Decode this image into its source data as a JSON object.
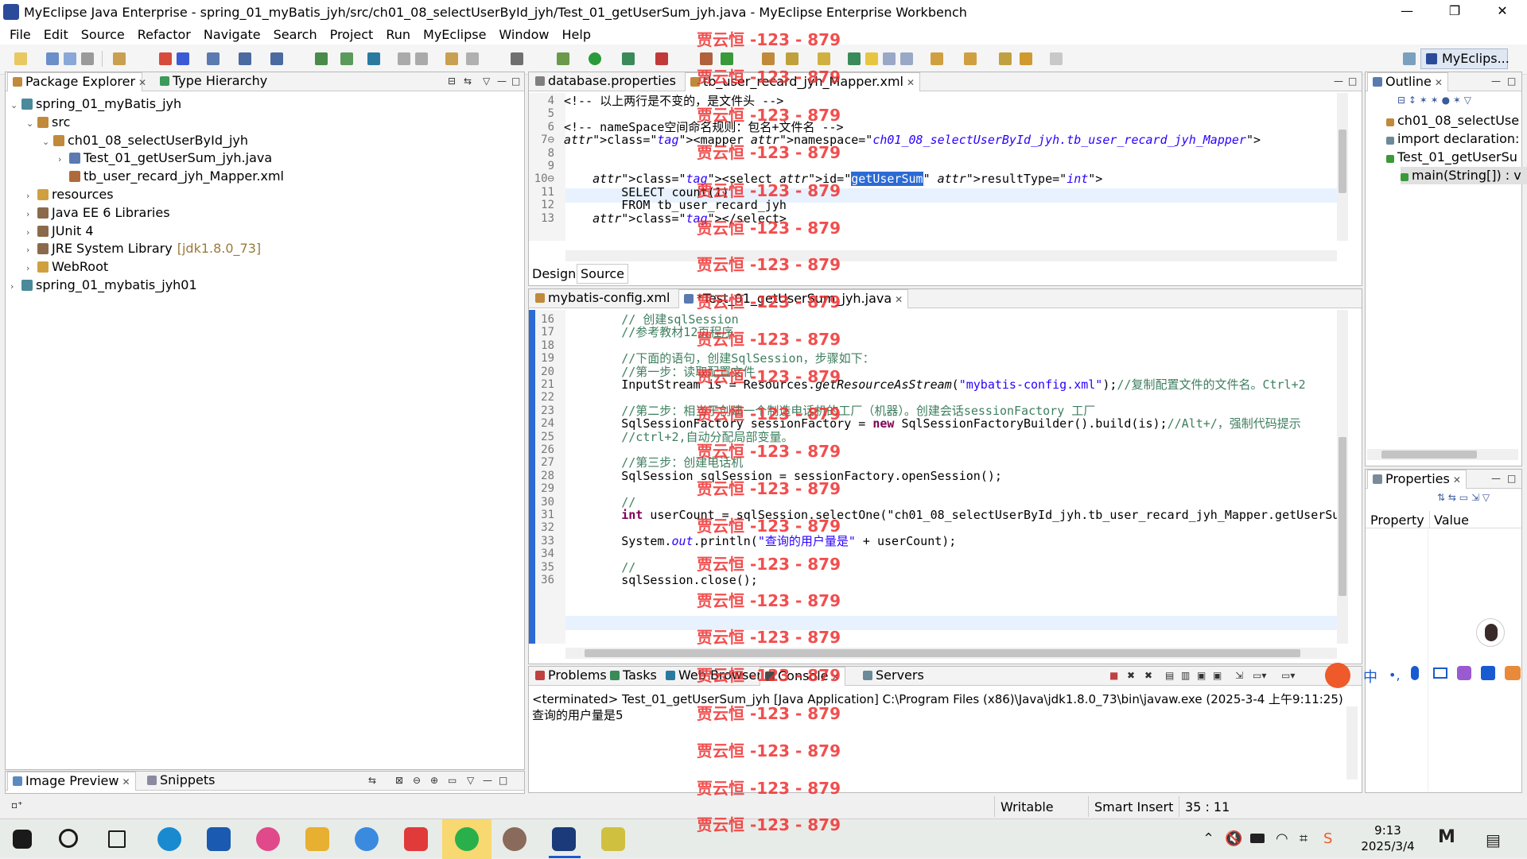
{
  "window": {
    "title": "MyEclipse Java Enterprise - spring_01_myBatis_jyh/src/ch01_08_selectUserById_jyh/Test_01_getUserSum_jyh.java - MyEclipse Enterprise Workbench",
    "minimize": "—",
    "restore": "❐",
    "close": "✕"
  },
  "menu": [
    "File",
    "Edit",
    "Source",
    "Refactor",
    "Navigate",
    "Search",
    "Project",
    "Run",
    "MyEclipse",
    "Window",
    "Help"
  ],
  "perspective": {
    "label": "MyEclips..."
  },
  "package_explorer": {
    "tabs": [
      {
        "label": "Package Explorer"
      },
      {
        "label": "Type Hierarchy"
      }
    ],
    "tree": [
      {
        "label": "spring_01_myBatis_jyh",
        "depth": 0,
        "arrow": "⌄",
        "icon": "project-icon"
      },
      {
        "label": "src",
        "depth": 1,
        "arrow": "⌄",
        "icon": "source-folder-icon"
      },
      {
        "label": "ch01_08_selectUserById_jyh",
        "depth": 2,
        "arrow": "⌄",
        "icon": "package-icon"
      },
      {
        "label": "Test_01_getUserSum_jyh.java",
        "depth": 3,
        "arrow": "›",
        "icon": "java-file-icon"
      },
      {
        "label": "tb_user_recard_jyh_Mapper.xml",
        "depth": 3,
        "arrow": "",
        "icon": "xml-file-icon"
      },
      {
        "label": "resources",
        "depth": 1,
        "arrow": "›",
        "icon": "folder-icon"
      },
      {
        "label": "Java EE 6 Libraries",
        "depth": 1,
        "arrow": "›",
        "icon": "library-icon"
      },
      {
        "label": "JUnit 4",
        "depth": 1,
        "arrow": "›",
        "icon": "library-icon"
      },
      {
        "label": "JRE System Library",
        "suffix": "[jdk1.8.0_73]",
        "depth": 1,
        "arrow": "›",
        "icon": "library-icon"
      },
      {
        "label": "WebRoot",
        "depth": 1,
        "arrow": "›",
        "icon": "folder-icon"
      },
      {
        "label": "spring_01_mybatis_jyh01",
        "depth": 0,
        "arrow": "›",
        "icon": "project-icon"
      }
    ]
  },
  "xml_editor": {
    "tabs": [
      {
        "label": "database.properties"
      },
      {
        "label": "tb_user_recard_jyh_Mapper.xml"
      }
    ],
    "bottom_tabs": [
      {
        "label": "Design"
      },
      {
        "label": "Source"
      }
    ],
    "lines": [
      {
        "n": "4",
        "text": "<!-- 以上两行是不变的，是文件头 -->"
      },
      {
        "n": "5",
        "text": ""
      },
      {
        "n": "6",
        "text": "<!-- nameSpace空间命名规则：包名+文件名 -->"
      },
      {
        "n": "7⊖",
        "text": "<mapper namespace=\"ch01_08_selectUserById_jyh.tb_user_recard_jyh_Mapper\">"
      },
      {
        "n": "8",
        "text": ""
      },
      {
        "n": "9",
        "text": ""
      },
      {
        "n": "10⊖",
        "text": "    <select id=\"getUserSum\" resultType=\"int\">"
      },
      {
        "n": "11",
        "text": "        SELECT count(1)"
      },
      {
        "n": "12",
        "text": "        FROM tb_user_recard_jyh"
      },
      {
        "n": "13",
        "text": "    </select>"
      }
    ]
  },
  "java_editor": {
    "tabs": [
      {
        "label": "mybatis-config.xml"
      },
      {
        "label": "*Test_01_getUserSum_jyh.java"
      }
    ],
    "lines": [
      {
        "n": "16",
        "text": "        // 创建sqlSession"
      },
      {
        "n": "17",
        "text": "        //参考教材12页程序"
      },
      {
        "n": "18",
        "text": ""
      },
      {
        "n": "19",
        "text": "        //下面的语句，创建SqlSession，步骤如下："
      },
      {
        "n": "20",
        "text": "        //第一步：读取配置文件"
      },
      {
        "n": "21",
        "text": "        InputStream is = Resources.getResourceAsStream(\"mybatis-config.xml\");//复制配置文件的文件名。Ctrl+2"
      },
      {
        "n": "22",
        "text": ""
      },
      {
        "n": "23",
        "text": "        //第二步：相当于创建一个制造电话机的工厂（机器）。创建会话sessionFactory 工厂"
      },
      {
        "n": "24",
        "text": "        SqlSessionFactory sessionFactory = new SqlSessionFactoryBuilder().build(is);//Alt+/，强制代码提示"
      },
      {
        "n": "25",
        "text": "        //ctrl+2,自动分配局部变量。"
      },
      {
        "n": "26",
        "text": ""
      },
      {
        "n": "27",
        "text": "        //第三步：创建电话机"
      },
      {
        "n": "28",
        "text": "        SqlSession sqlSession = sessionFactory.openSession();"
      },
      {
        "n": "29",
        "text": ""
      },
      {
        "n": "30",
        "text": "        //"
      },
      {
        "n": "31",
        "text": "        int userCount = sqlSession.selectOne(\"ch01_08_selectUserById_jyh.tb_user_recard_jyh_Mapper.getUserSu"
      },
      {
        "n": "32",
        "text": ""
      },
      {
        "n": "33",
        "text": "        System.out.println(\"查询的用户量是\" + userCount);"
      },
      {
        "n": "34",
        "text": ""
      },
      {
        "n": "35",
        "text": "        //"
      },
      {
        "n": "36",
        "text": "        sqlSession.close();"
      }
    ]
  },
  "outline": {
    "tab": "Outline",
    "items": [
      {
        "label": "ch01_08_selectUse",
        "icon": "package-icon"
      },
      {
        "label": "import declaration:",
        "icon": "import-icon"
      },
      {
        "label": "Test_01_getUserSu",
        "icon": "class-icon"
      },
      {
        "label": "main(String[]) : v",
        "icon": "method-icon"
      }
    ]
  },
  "properties": {
    "tab": "Properties",
    "col_property": "Property",
    "col_value": "Value"
  },
  "console": {
    "tabs": [
      {
        "label": "Problems"
      },
      {
        "label": "Tasks"
      },
      {
        "label": "Web Browser"
      },
      {
        "label": "Console"
      },
      {
        "label": "Servers"
      }
    ],
    "header": "<terminated> Test_01_getUserSum_jyh [Java Application] C:\\Program Files (x86)\\Java\\jdk1.8.0_73\\bin\\javaw.exe (2025-3-4 上午9:11:25)",
    "output": "查询的用户量是5"
  },
  "bottom_left": {
    "tabs": [
      {
        "label": "Image Preview"
      },
      {
        "label": "Snippets"
      }
    ]
  },
  "status": {
    "writable": "Writable",
    "insert": "Smart Insert",
    "position": "35 : 11"
  },
  "watermark": "贾云恒 -123 - 879",
  "taskbar": {
    "time": "9:13",
    "date": "2025/3/4",
    "ime": "中"
  },
  "colors": {
    "selection": "#2c6ad4",
    "watermark": "#f03030",
    "comment": "#3f7f5f",
    "keyword": "#7f0055",
    "string": "#2a00ff"
  }
}
